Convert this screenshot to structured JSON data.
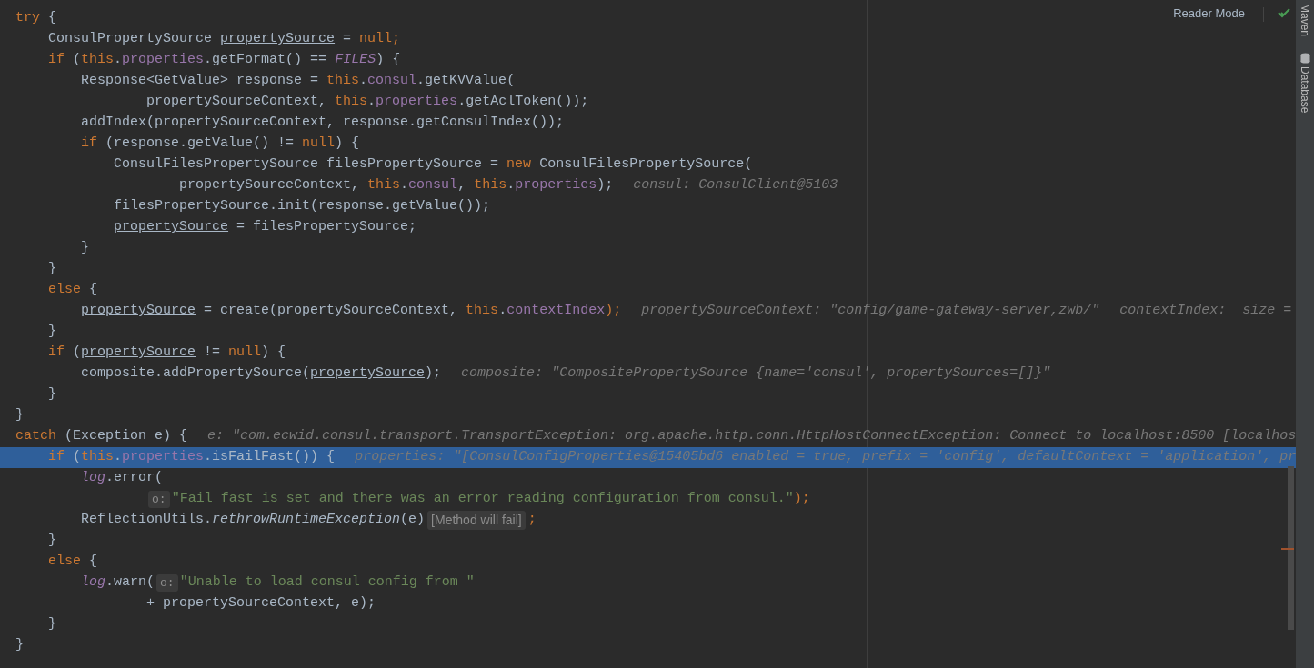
{
  "editor": {
    "lines": [
      {
        "highlighted": false,
        "tokens": [
          {
            "kind": "keyword",
            "text": "try"
          },
          {
            "kind": "plain",
            "text": " {"
          }
        ]
      },
      {
        "highlighted": false,
        "tokens": [
          {
            "kind": "plain",
            "text": "    ConsulPropertySource "
          },
          {
            "kind": "underlined",
            "text": "propertySource"
          },
          {
            "kind": "plain",
            "text": " = "
          },
          {
            "kind": "keyword",
            "text": "null;"
          }
        ]
      },
      {
        "highlighted": false,
        "tokens": [
          {
            "kind": "keyword",
            "text": "    if"
          },
          {
            "kind": "plain",
            "text": " ("
          },
          {
            "kind": "keyword",
            "text": "this"
          },
          {
            "kind": "plain",
            "text": "."
          },
          {
            "kind": "field",
            "text": "properties"
          },
          {
            "kind": "plain",
            "text": ".getFormat() == "
          },
          {
            "kind": "static",
            "text": "FILES"
          },
          {
            "kind": "plain",
            "text": ") {"
          }
        ]
      },
      {
        "highlighted": false,
        "tokens": [
          {
            "kind": "plain",
            "text": "        Response<GetValue> response = "
          },
          {
            "kind": "keyword",
            "text": "this"
          },
          {
            "kind": "plain",
            "text": "."
          },
          {
            "kind": "field",
            "text": "consul"
          },
          {
            "kind": "plain",
            "text": ".getKVValue("
          }
        ]
      },
      {
        "highlighted": false,
        "tokens": [
          {
            "kind": "plain",
            "text": "                propertySourceContext, "
          },
          {
            "kind": "keyword",
            "text": "this"
          },
          {
            "kind": "plain",
            "text": "."
          },
          {
            "kind": "field",
            "text": "properties"
          },
          {
            "kind": "plain",
            "text": ".getAclToken());"
          }
        ]
      },
      {
        "highlighted": false,
        "tokens": [
          {
            "kind": "plain",
            "text": "        addIndex(propertySourceContext, response.getConsulIndex());"
          }
        ]
      },
      {
        "highlighted": false,
        "tokens": [
          {
            "kind": "keyword",
            "text": "        if"
          },
          {
            "kind": "plain",
            "text": " (response.getValue() != "
          },
          {
            "kind": "keyword",
            "text": "null"
          },
          {
            "kind": "plain",
            "text": ") {"
          }
        ]
      },
      {
        "highlighted": false,
        "tokens": [
          {
            "kind": "plain",
            "text": "            ConsulFilesPropertySource filesPropertySource = "
          },
          {
            "kind": "keyword",
            "text": "new"
          },
          {
            "kind": "plain",
            "text": " ConsulFilesPropertySource("
          }
        ]
      },
      {
        "highlighted": false,
        "tokens": [
          {
            "kind": "plain",
            "text": "                    propertySourceContext, "
          },
          {
            "kind": "keyword",
            "text": "this"
          },
          {
            "kind": "plain",
            "text": "."
          },
          {
            "kind": "field",
            "text": "consul"
          },
          {
            "kind": "plain",
            "text": ", "
          },
          {
            "kind": "keyword",
            "text": "this"
          },
          {
            "kind": "plain",
            "text": "."
          },
          {
            "kind": "field",
            "text": "properties"
          },
          {
            "kind": "plain",
            "text": ");"
          },
          {
            "kind": "value_hint",
            "text": "consul: ConsulClient@5103"
          }
        ]
      },
      {
        "highlighted": false,
        "tokens": [
          {
            "kind": "plain",
            "text": "            filesPropertySource.init(response.getValue());"
          }
        ]
      },
      {
        "highlighted": false,
        "tokens": [
          {
            "kind": "underlined",
            "text": "            propertySource"
          },
          {
            "kind": "plain",
            "text": " = filesPropertySource;"
          }
        ]
      },
      {
        "highlighted": false,
        "tokens": [
          {
            "kind": "plain",
            "text": "        }"
          }
        ]
      },
      {
        "highlighted": false,
        "tokens": [
          {
            "kind": "plain",
            "text": "    }"
          }
        ]
      },
      {
        "highlighted": false,
        "tokens": [
          {
            "kind": "keyword",
            "text": "    else"
          },
          {
            "kind": "plain",
            "text": " {"
          }
        ]
      },
      {
        "highlighted": false,
        "tokens": [
          {
            "kind": "underlined",
            "text": "        propertySource"
          },
          {
            "kind": "plain",
            "text": " = create(propertySourceContext, "
          },
          {
            "kind": "keyword",
            "text": "this"
          },
          {
            "kind": "plain",
            "text": "."
          },
          {
            "kind": "field",
            "text": "contextIndex"
          },
          {
            "kind": "keyword",
            "text": ");"
          },
          {
            "kind": "value_hint",
            "text": "propertySourceContext: \"config/game-gateway-server,zwb/\""
          },
          {
            "kind": "value_hint",
            "text": "contextIndex:  size ="
          }
        ]
      },
      {
        "highlighted": false,
        "tokens": [
          {
            "kind": "plain",
            "text": "    }"
          }
        ]
      },
      {
        "highlighted": false,
        "tokens": [
          {
            "kind": "keyword",
            "text": "    if"
          },
          {
            "kind": "plain",
            "text": " ("
          },
          {
            "kind": "underlined",
            "text": "propertySource"
          },
          {
            "kind": "plain",
            "text": " != "
          },
          {
            "kind": "keyword",
            "text": "null"
          },
          {
            "kind": "plain",
            "text": ") {"
          }
        ]
      },
      {
        "highlighted": false,
        "tokens": [
          {
            "kind": "plain",
            "text": "        composite.addPropertySource("
          },
          {
            "kind": "underlined",
            "text": "propertySource"
          },
          {
            "kind": "plain",
            "text": ");"
          },
          {
            "kind": "value_hint",
            "text": "composite: \"CompositePropertySource {name='consul', propertySources=[]}\""
          }
        ]
      },
      {
        "highlighted": false,
        "tokens": [
          {
            "kind": "plain",
            "text": "    }"
          }
        ]
      },
      {
        "highlighted": false,
        "tokens": [
          {
            "kind": "plain",
            "text": "}"
          }
        ]
      },
      {
        "highlighted": false,
        "tokens": [
          {
            "kind": "keyword",
            "text": "catch"
          },
          {
            "kind": "plain",
            "text": " (Exception e) {"
          },
          {
            "kind": "value_hint",
            "text": "e: \"com.ecwid.consul.transport.TransportException: org.apache.http.conn.HttpHostConnectException: Connect to localhost:8500 [localhos"
          }
        ]
      },
      {
        "highlighted": true,
        "tokens": [
          {
            "kind": "keyword",
            "text": "    if"
          },
          {
            "kind": "plain",
            "text": " ("
          },
          {
            "kind": "keyword",
            "text": "this"
          },
          {
            "kind": "plain",
            "text": "."
          },
          {
            "kind": "field",
            "text": "properties"
          },
          {
            "kind": "plain",
            "text": ".isFailFast()) {"
          },
          {
            "kind": "value_hint",
            "text": "properties: \"[ConsulConfigProperties@15405bd6 enabled = true, prefix = 'config', defaultContext = 'application', pr"
          }
        ]
      },
      {
        "highlighted": false,
        "tokens": [
          {
            "kind": "static",
            "text": "        log"
          },
          {
            "kind": "plain",
            "text": ".error("
          }
        ]
      },
      {
        "highlighted": false,
        "tokens": [
          {
            "kind": "param_hint",
            "text": "o:"
          },
          {
            "kind": "string",
            "text": "\"Fail fast is set and there was an error reading configuration from consul.\""
          },
          {
            "kind": "keyword",
            "text": ");"
          }
        ]
      },
      {
        "highlighted": false,
        "tokens": [
          {
            "kind": "plain",
            "text": "        ReflectionUtils."
          },
          {
            "kind": "italic",
            "text": "rethrowRuntimeException"
          },
          {
            "kind": "plain",
            "text": "(e)"
          },
          {
            "kind": "inline_hint",
            "text": "[Method will fail]"
          },
          {
            "kind": "keyword",
            "text": ";"
          }
        ]
      },
      {
        "highlighted": false,
        "tokens": [
          {
            "kind": "plain",
            "text": "    }"
          }
        ]
      },
      {
        "highlighted": false,
        "tokens": [
          {
            "kind": "keyword",
            "text": "    else"
          },
          {
            "kind": "plain",
            "text": " {"
          }
        ]
      },
      {
        "highlighted": false,
        "tokens": [
          {
            "kind": "static",
            "text": "        log"
          },
          {
            "kind": "plain",
            "text": ".warn("
          },
          {
            "kind": "param_hint",
            "text": "o:"
          },
          {
            "kind": "string",
            "text": "\"Unable to load consul config from \""
          }
        ]
      },
      {
        "highlighted": false,
        "tokens": [
          {
            "kind": "plain",
            "text": "                + propertySourceContext, e);"
          }
        ]
      },
      {
        "highlighted": false,
        "tokens": [
          {
            "kind": "plain",
            "text": "    }"
          }
        ]
      },
      {
        "highlighted": false,
        "tokens": [
          {
            "kind": "plain",
            "text": "}"
          }
        ]
      }
    ]
  },
  "reader_mode": "Reader Mode",
  "tool_strip": [
    {
      "label": "Maven"
    },
    {
      "label": "Database"
    }
  ]
}
